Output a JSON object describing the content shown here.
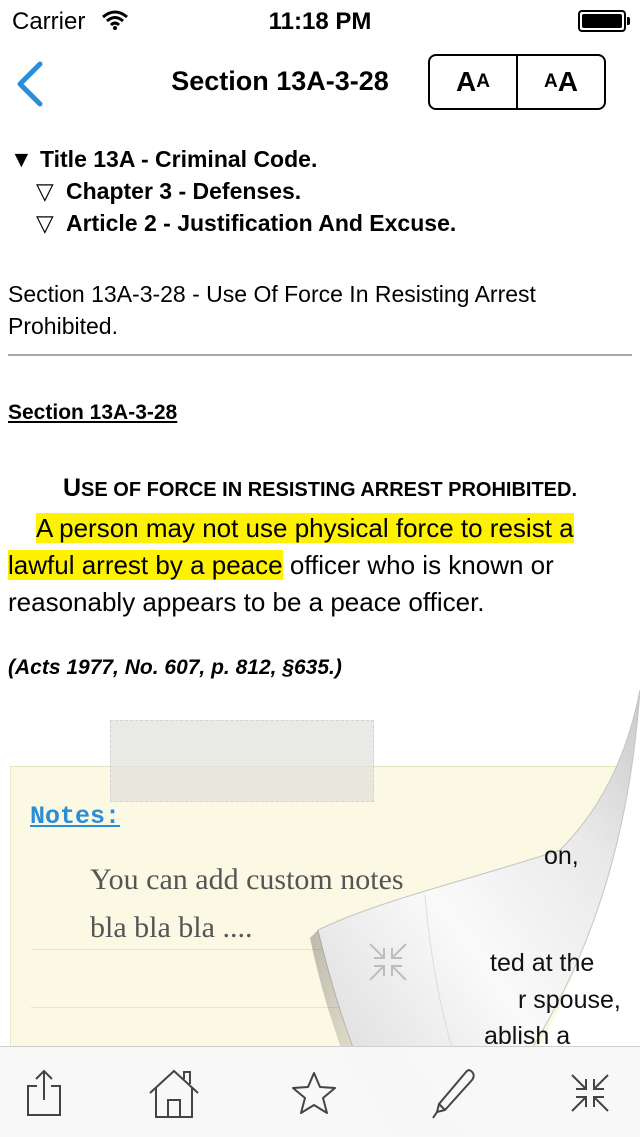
{
  "status": {
    "carrier": "Carrier",
    "time": "11:18 PM"
  },
  "nav": {
    "title": "Section 13A-3-28",
    "font_decrease_label": "A",
    "font_increase_label": "A"
  },
  "breadcrumbs": [
    {
      "glyph": "▼",
      "text": "Title 13A - Criminal Code."
    },
    {
      "glyph": "▽",
      "text": "Chapter 3 - Defenses."
    },
    {
      "glyph": "▽",
      "text": "Article 2 - Justification And Excuse."
    }
  ],
  "section": {
    "heading": "Section 13A-3-28 - Use Of Force In Resisting Arrest Prohibited.",
    "label": "Section 13A-3-28",
    "caption_first": "U",
    "caption_rest": "SE OF FORCE IN RESISTING ARREST PROHIBITED.",
    "body_highlighted": "A person may not use physical force to resist a lawful arrest by a peace",
    "body_rest": " officer who is known or reasonably appears to be a peace officer.",
    "history": "(Acts 1977, No. 607, p. 812, §635.)"
  },
  "notes": {
    "title": "Notes:",
    "text": "You can add custom notes",
    "text2": "bla bla bla ....",
    "peek": [
      "on,",
      "ted at the",
      "r spouse,",
      "ablish a"
    ]
  },
  "colors": {
    "accent": "#2a8dd8",
    "highlight": "#fff200",
    "note_bg": "#fbf8e4"
  },
  "toolbar": [
    "share-icon",
    "home-icon",
    "star-icon",
    "pen-icon",
    "collapse-icon"
  ]
}
